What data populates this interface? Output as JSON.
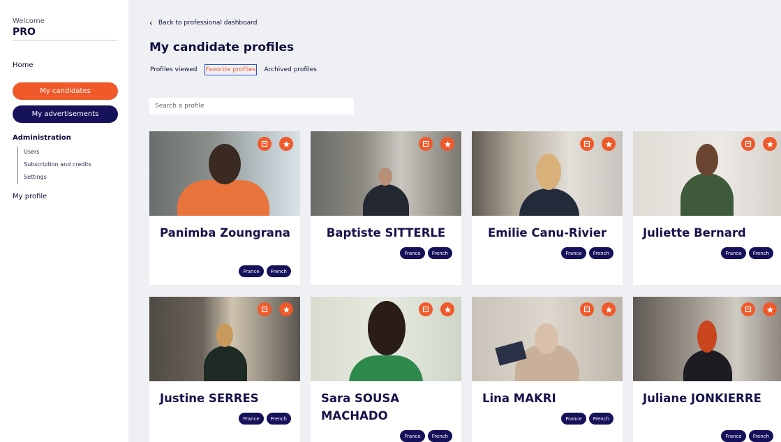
{
  "sidebar": {
    "welcome": "Welcome",
    "role": "PRO",
    "home": "Home",
    "my_candidates": "My candidates",
    "my_advertisements": "My advertisements",
    "administration": "Administration",
    "admin_items": [
      "Users",
      "Subscription and credits",
      "Settings"
    ],
    "my_profile": "My profile"
  },
  "header": {
    "back_label": "Back to professional dashboard",
    "title": "My candidate profiles"
  },
  "tabs": [
    {
      "label": "Profiles viewed",
      "active": false
    },
    {
      "label": "Favorite profiles",
      "active": true
    },
    {
      "label": "Archived profiles",
      "active": false
    }
  ],
  "search": {
    "placeholder": "Search a profile",
    "value": ""
  },
  "colors": {
    "accent": "#f0592a",
    "navy": "#15115a",
    "background": "#eff0f4"
  },
  "icons": {
    "archive": "archive-icon",
    "favorite": "star-icon",
    "back": "chevron-left-icon"
  },
  "candidates": [
    {
      "name": "Panimba Zoungrana",
      "tags": [
        "France",
        "French"
      ]
    },
    {
      "name": "Baptiste SITTERLE",
      "tags": [
        "France",
        "French"
      ]
    },
    {
      "name": "Emilie Canu-Rivier",
      "tags": [
        "France",
        "French"
      ]
    },
    {
      "name": "Juliette Bernard",
      "tags": [
        "France",
        "French"
      ]
    },
    {
      "name": "Justine SERRES",
      "tags": [
        "France",
        "French"
      ]
    },
    {
      "name": "Sara SOUSA MACHADO",
      "tags": [
        "France",
        "French"
      ]
    },
    {
      "name": "Lina MAKRI",
      "tags": [
        "France",
        "French"
      ]
    },
    {
      "name": "Juliane JONKIERRE",
      "tags": [
        "France",
        "French"
      ]
    }
  ]
}
